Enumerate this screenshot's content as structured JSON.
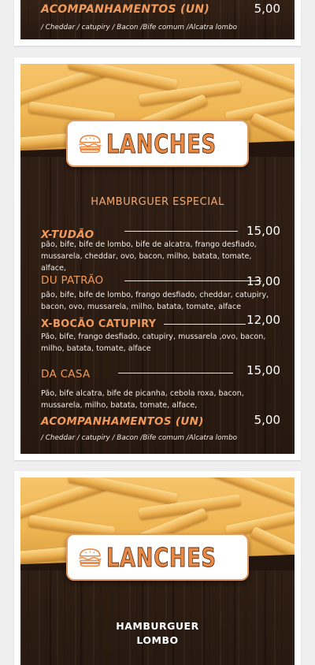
{
  "top_card": {
    "item_name": "ACOMPANHAMENTOS (UN)",
    "item_price": "5,00",
    "item_desc": "/ Cheddar /  catupiry / Bacon /Bife comum /Alcatra lombo"
  },
  "menu_card": {
    "banner_title": "LANCHES",
    "banner_icon": "burger-icon",
    "section_title": "HAMBURGUER ESPECIAL",
    "items": [
      {
        "name": "X-TUDÃO",
        "price": "15,00",
        "desc": "pão, bife, bife de lombo, bife de alcatra, frango desfiado, mussarela, cheddar, ovo, bacon, milho, batata, tomate, alface,"
      },
      {
        "name": "DU PATRÃO",
        "price": "13,00",
        "desc": "pão, bife, bife de lombo, frango desfiado, cheddar, catupiry, bacon, ovo, mussarela, milho, batata, tomate, alface"
      },
      {
        "name": "X-BOCÃO CATUPIRY",
        "price": "12,00",
        "desc": "Pão, bife,  frango desfiado, catupiry, mussarela ,ovo, bacon, milho, batata, tomate, alface"
      },
      {
        "name": "DA CASA",
        "price": "15,00",
        "desc": "Pão, bife alcatra, bife de picanha, cebola roxa, bacon, mussarela,  milho, batata, tomate, alface,"
      },
      {
        "name": "ACOMPANHAMENTOS (UN)",
        "price": "5,00",
        "desc": "/ Cheddar /  catupiry / Bacon /Bife comum /Alcatra lombo"
      }
    ]
  },
  "bottom_card": {
    "banner_title": "LANCHES",
    "banner_icon": "burger-icon",
    "section_title_line1": "HAMBURGUER",
    "section_title_line2": "LOMBO"
  },
  "colors": {
    "accent_orange": "#f09a5c",
    "wood_dark": "#23160e",
    "text_light": "#f1ece7"
  }
}
